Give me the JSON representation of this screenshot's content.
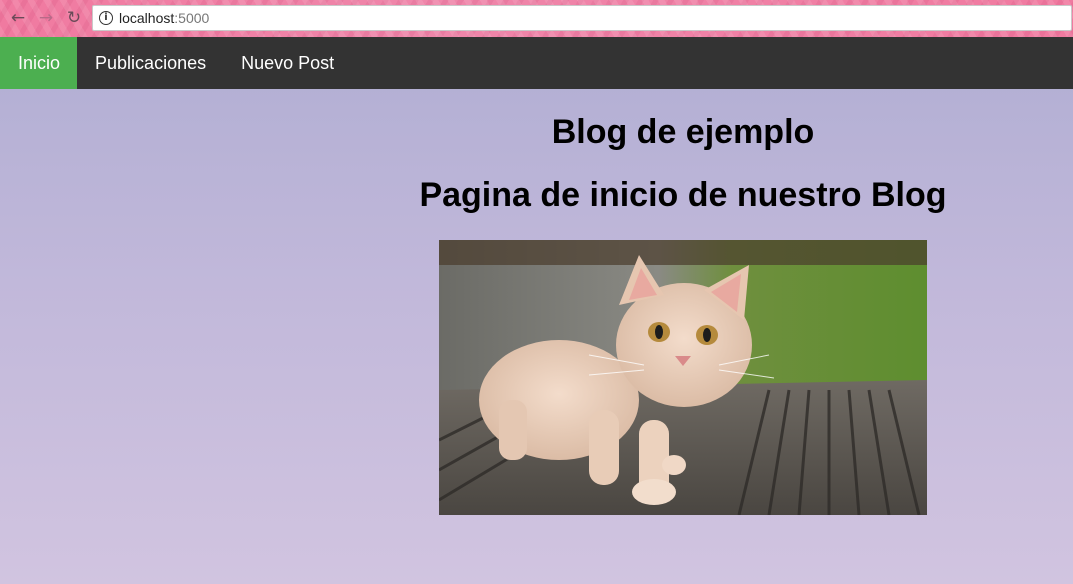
{
  "browser": {
    "url_host": "localhost",
    "url_port": ":5000"
  },
  "navbar": {
    "items": [
      {
        "label": "Inicio",
        "active": true
      },
      {
        "label": "Publicaciones",
        "active": false
      },
      {
        "label": "Nuevo Post",
        "active": false
      }
    ]
  },
  "main": {
    "title": "Blog de ejemplo",
    "subtitle": "Pagina de inicio de nuestro Blog"
  },
  "colors": {
    "navbar_bg": "#333333",
    "active_item": "#4caf50"
  }
}
